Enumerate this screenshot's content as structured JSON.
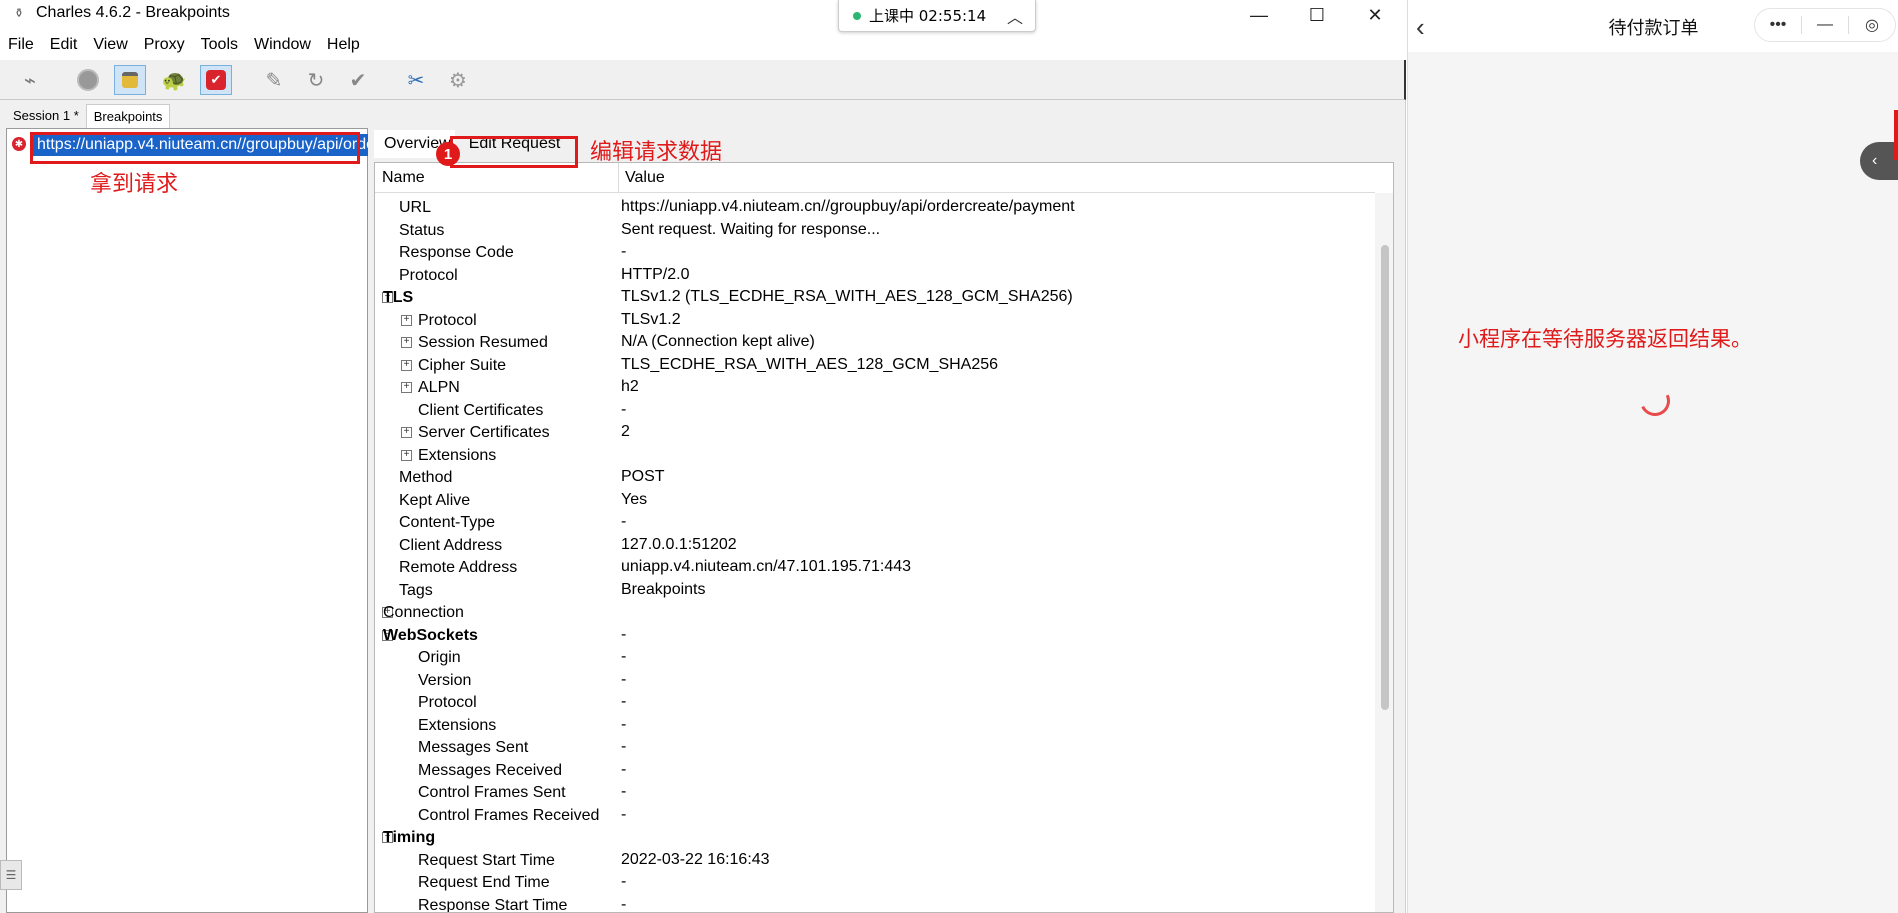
{
  "window": {
    "title": "Charles 4.6.2 - Breakpoints",
    "minimize": "—",
    "maximize": "☐",
    "close": "✕"
  },
  "menu": [
    "File",
    "Edit",
    "View",
    "Proxy",
    "Tools",
    "Window",
    "Help"
  ],
  "toolbar_icons": [
    "broom-icon",
    "record-icon",
    "lock-icon",
    "turtle-icon",
    "breakpoint-icon",
    "pen-icon",
    "refresh-icon",
    "check-icon",
    "tools-icon",
    "gear-icon"
  ],
  "session_tabs": [
    "Session 1 *",
    "Breakpoints"
  ],
  "request": {
    "url": "https://uniapp.v4.niuteam.cn//groupbuy/api/ordercreate/payment"
  },
  "annotations": {
    "get_request": "拿到请求",
    "edit_request_data": "编辑请求数据",
    "badge": "1",
    "mini_waiting": "小程序在等待服务器返回结果。"
  },
  "detail_tabs": [
    "Overview",
    "Edit Request"
  ],
  "columns": {
    "name": "Name",
    "value": "Value"
  },
  "rows": [
    {
      "name": "URL",
      "value": "https://uniapp.v4.niuteam.cn//groupbuy/api/ordercreate/payment",
      "level": 1
    },
    {
      "name": "Status",
      "value": "Sent request. Waiting for response...",
      "level": 1
    },
    {
      "name": "Response Code",
      "value": "-",
      "level": 1
    },
    {
      "name": "Protocol",
      "value": "HTTP/2.0",
      "level": 1
    },
    {
      "name": "TLS",
      "value": "TLSv1.2 (TLS_ECDHE_RSA_WITH_AES_128_GCM_SHA256)",
      "level": 0,
      "bold": true,
      "toggle": "−"
    },
    {
      "name": "Protocol",
      "value": "TLSv1.2",
      "level": 2,
      "toggle": "+"
    },
    {
      "name": "Session Resumed",
      "value": "N/A (Connection kept alive)",
      "level": 2,
      "toggle": "+"
    },
    {
      "name": "Cipher Suite",
      "value": "TLS_ECDHE_RSA_WITH_AES_128_GCM_SHA256",
      "level": 2,
      "toggle": "+"
    },
    {
      "name": "ALPN",
      "value": "h2",
      "level": 2,
      "toggle": "+"
    },
    {
      "name": "Client Certificates",
      "value": "-",
      "level": 2
    },
    {
      "name": "Server Certificates",
      "value": "2",
      "level": 2,
      "toggle": "+"
    },
    {
      "name": "Extensions",
      "value": "",
      "level": 2,
      "toggle": "+"
    },
    {
      "name": "Method",
      "value": "POST",
      "level": 1
    },
    {
      "name": "Kept Alive",
      "value": "Yes",
      "level": 1
    },
    {
      "name": "Content-Type",
      "value": "-",
      "level": 1
    },
    {
      "name": "Client Address",
      "value": "127.0.0.1:51202",
      "level": 1
    },
    {
      "name": "Remote Address",
      "value": "uniapp.v4.niuteam.cn/47.101.195.71:443",
      "level": 1
    },
    {
      "name": "Tags",
      "value": "Breakpoints",
      "level": 1
    },
    {
      "name": "Connection",
      "value": "",
      "level": 0,
      "toggle": "+"
    },
    {
      "name": "WebSockets",
      "value": "-",
      "level": 0,
      "bold": true,
      "toggle": "−"
    },
    {
      "name": "Origin",
      "value": "-",
      "level": 2
    },
    {
      "name": "Version",
      "value": "-",
      "level": 2
    },
    {
      "name": "Protocol",
      "value": "-",
      "level": 2
    },
    {
      "name": "Extensions",
      "value": "-",
      "level": 2
    },
    {
      "name": "Messages Sent",
      "value": "-",
      "level": 2
    },
    {
      "name": "Messages Received",
      "value": "-",
      "level": 2
    },
    {
      "name": "Control Frames Sent",
      "value": "-",
      "level": 2
    },
    {
      "name": "Control Frames Received",
      "value": "-",
      "level": 2
    },
    {
      "name": "Timing",
      "value": "",
      "level": 0,
      "bold": true,
      "toggle": "−"
    },
    {
      "name": "Request Start Time",
      "value": "2022-03-22 16:16:43",
      "level": 2
    },
    {
      "name": "Request End Time",
      "value": "-",
      "level": 2
    },
    {
      "name": "Response Start Time",
      "value": "-",
      "level": 2
    }
  ],
  "notification": {
    "text": "上课中 02:55:14"
  },
  "mini_program": {
    "title": "待付款订单",
    "capsule_more": "•••",
    "capsule_min": "—",
    "capsule_close": "◎",
    "back": "‹",
    "float": "‹"
  }
}
